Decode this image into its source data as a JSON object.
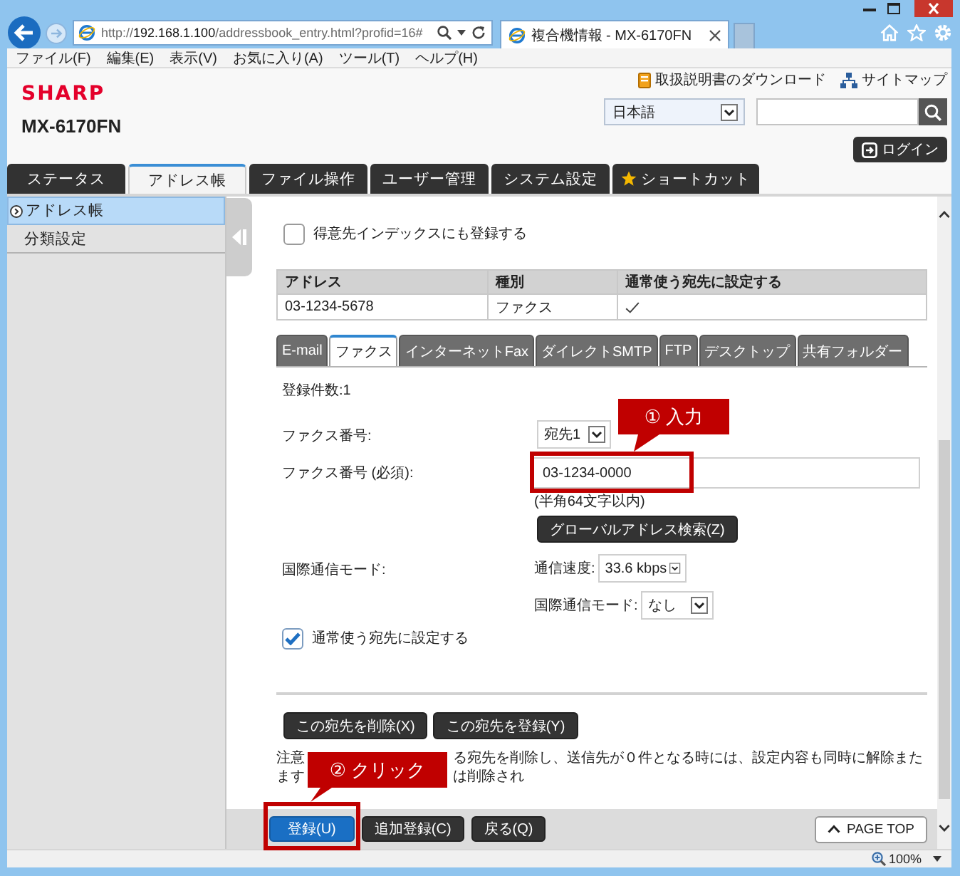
{
  "browser": {
    "address": {
      "prefix": "http://",
      "host": "192.168.1.100",
      "path": "/addressbook_entry.html?profid=16#"
    },
    "tab_title": "複合機情報 - MX-6170FN",
    "menu": [
      "ファイル(F)",
      "編集(E)",
      "表示(V)",
      "お気に入り(A)",
      "ツール(T)",
      "ヘルプ(H)"
    ]
  },
  "header": {
    "logo": "SHARP",
    "model": "MX-6170FN",
    "links": [
      {
        "label": "取扱説明書のダウンロード",
        "kind": "manual"
      },
      {
        "label": "サイトマップ",
        "kind": "sitemap"
      }
    ],
    "language": "日本語",
    "login": "ログイン"
  },
  "nav_tabs": [
    {
      "label": "ステータス",
      "kind": "plain",
      "selected": false
    },
    {
      "label": "アドレス帳",
      "kind": "plain",
      "selected": true
    },
    {
      "label": "ファイル操作",
      "kind": "plain",
      "selected": false
    },
    {
      "label": "ユーザー管理",
      "kind": "plain",
      "selected": false
    },
    {
      "label": "システム設定",
      "kind": "plain",
      "selected": false
    },
    {
      "label": "ショートカット",
      "kind": "shortcut",
      "selected": false
    }
  ],
  "sidebar": {
    "items": [
      {
        "label": "アドレス帳",
        "selected": true
      },
      {
        "label": "分類設定",
        "selected": false
      }
    ]
  },
  "content": {
    "index_checkbox": {
      "label": "得意先インデックスにも登録する",
      "checked": false
    },
    "address_table": {
      "columns": [
        "アドレス",
        "種別",
        "通常使う宛先に設定する"
      ],
      "rows": [
        {
          "address": "03-1234-5678",
          "type": "ファクス",
          "default": true
        }
      ]
    },
    "sub_tabs": [
      {
        "label": "E-mail",
        "selected": false
      },
      {
        "label": "ファクス",
        "selected": true
      },
      {
        "label": "インターネットFax",
        "selected": false
      },
      {
        "label": "ダイレクトSMTP",
        "selected": false
      },
      {
        "label": "FTP",
        "selected": false
      },
      {
        "label": "デスクトップ",
        "selected": false
      },
      {
        "label": "共有フォルダー",
        "selected": false
      }
    ],
    "count": "登録件数:1",
    "fax_slot": {
      "label": "ファクス番号:",
      "value": "宛先1"
    },
    "fax_number": {
      "label": "ファクス番号 (必須):",
      "value": "03-1234-0000",
      "caption": "(半角64文字以内)",
      "callout": "① 入力"
    },
    "global_search_button": "グローバルアドレス検索(Z)",
    "intl": {
      "label": "国際通信モード:",
      "speed": {
        "label": "通信速度:",
        "value": "33.6 kbps"
      },
      "mode": {
        "label": "国際通信モード:",
        "value": "なし"
      }
    },
    "default_checkbox": {
      "label": "通常使う宛先に設定する",
      "checked": true
    },
    "entry_buttons": [
      "この宛先を削除(X)",
      "この宛先を登録(Y)"
    ],
    "note": {
      "line_1_start": "注意",
      "line_1_end": "る宛先を削除し、送信先が０件となる時には、設定内容も同時に解除または削除され",
      "line_2_start": "ます"
    },
    "footer_buttons": [
      {
        "label": "登録(U)",
        "kind": "primary",
        "callout": "② クリック"
      },
      {
        "label": "追加登録(C)",
        "kind": "secondary"
      },
      {
        "label": "戻る(Q)",
        "kind": "secondary"
      }
    ],
    "page_top": "PAGE TOP"
  },
  "status_bar": {
    "zoom": "100%"
  }
}
